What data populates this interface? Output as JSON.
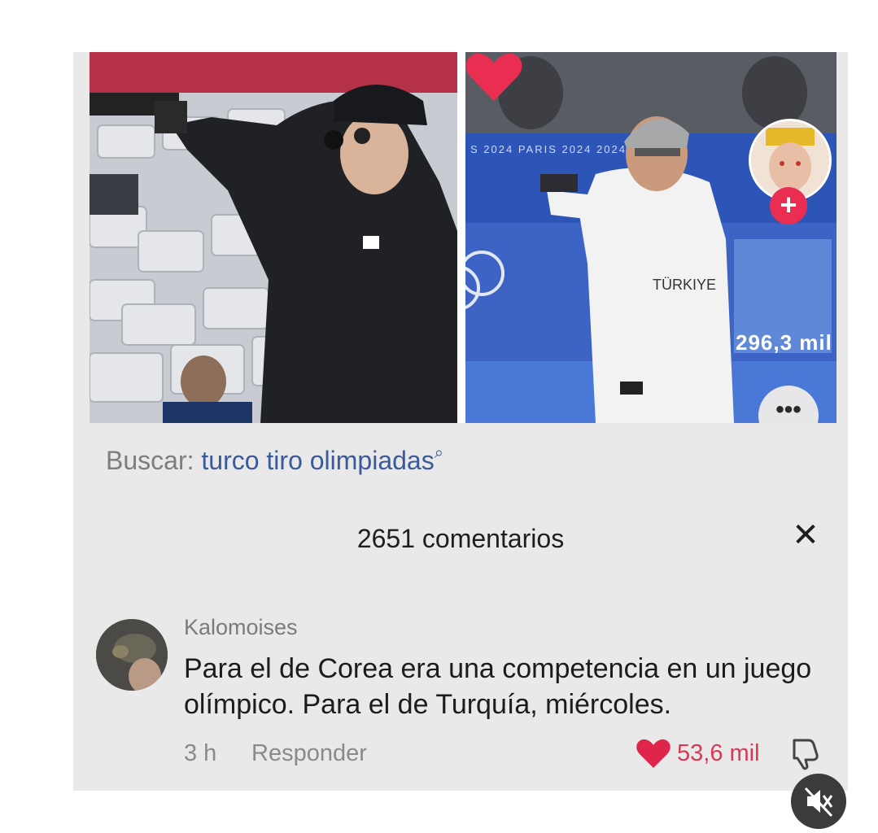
{
  "video": {
    "right_banner_text": "S 2024   PARIS 2024   2024",
    "shirt_text": "TÜRKIYE",
    "likes": "296,3 mil",
    "follow_symbol": "+",
    "more_symbol": "•••"
  },
  "search": {
    "label": "Buscar:",
    "query": "turco tiro olimpiadas",
    "icon_glyph": "⌕"
  },
  "comments": {
    "title": "2651 comentarios",
    "close_glyph": "✕",
    "items": [
      {
        "author": "Kalomoises",
        "text": "Para el de Corea era una competencia en un juego olímpico. Para el de Turquía, miércoles.",
        "time": "3 h",
        "reply_label": "Responder",
        "likes": "53,6 mil"
      }
    ]
  },
  "colors": {
    "accent_red": "#ea2e51",
    "link_blue": "#3b5a9a",
    "like_red": "#d63a55"
  }
}
